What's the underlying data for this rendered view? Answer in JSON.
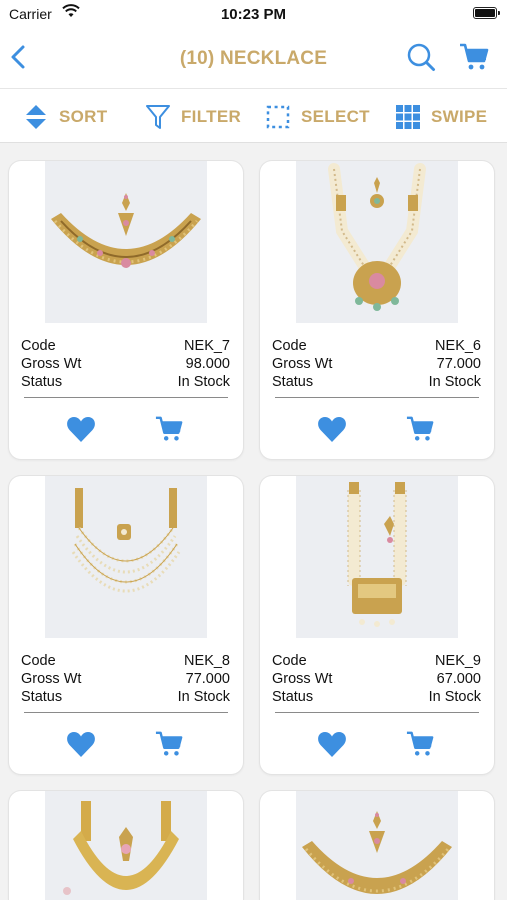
{
  "status_bar": {
    "carrier": "Carrier",
    "time": "10:23 PM"
  },
  "nav": {
    "title": "(10) NECKLACE"
  },
  "toolbar": {
    "sort": "SORT",
    "filter": "FILTER",
    "select": "SELECT",
    "swipe": "SWIPE"
  },
  "colors": {
    "accent_blue": "#3d8fe0",
    "gold_text": "#c9a96a"
  },
  "labels": {
    "code": "Code",
    "gross_wt": "Gross Wt",
    "status": "Status"
  },
  "products": [
    {
      "code": "NEK_7",
      "gross_wt": "98.000",
      "status": "In Stock"
    },
    {
      "code": "NEK_6",
      "gross_wt": "77.000",
      "status": "In Stock"
    },
    {
      "code": "NEK_8",
      "gross_wt": "77.000",
      "status": "In Stock"
    },
    {
      "code": "NEK_9",
      "gross_wt": "67.000",
      "status": "In Stock"
    },
    {
      "code": "",
      "gross_wt": "",
      "status": ""
    },
    {
      "code": "",
      "gross_wt": "",
      "status": ""
    }
  ]
}
